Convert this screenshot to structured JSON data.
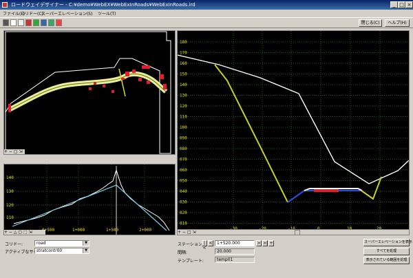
{
  "window": {
    "title": "ロードウェイデザイナー - C:¥demo¥WebEX¥WebExInRoads¥WebExInRoads.ird",
    "minimize": "_",
    "maximize": "□",
    "close": "×"
  },
  "menu": [
    "ファイル(F)",
    "コリドー(C)",
    "スーパーエレベーション(S)",
    "ツール(T)"
  ],
  "toolbar": {
    "close_label": "閉じる(C)",
    "help_label": "ヘルプ(H)"
  },
  "plan_minibar": "+ − □ ⇲",
  "profile_minibar": "+ − △ ▢ ⬚ ⇲",
  "xsection_minibar": "+ − □ ⇲",
  "profile_chart": {
    "y_ticks": [
      "140",
      "130",
      "120",
      "110"
    ],
    "x_ticks": [
      "0+500",
      "1+000",
      "1+500",
      "2+000"
    ]
  },
  "xsection_chart": {
    "y_ticks": [
      "180",
      "170",
      "160",
      "150",
      "140",
      "130",
      "120",
      "110",
      "100",
      "090",
      "080",
      "070",
      "060",
      "050",
      "040",
      "030",
      "020",
      "010"
    ],
    "x_ticks": [
      "-30",
      "-20",
      "-10",
      "0",
      "10",
      "20"
    ]
  },
  "form": {
    "corridor_label": "コリドー:",
    "corridor_value": "road",
    "surface_label": "アクティブなサーフェス:",
    "surface_value": "stratcontr00",
    "station_label": "ステーション:",
    "station_value": "1+520.000",
    "interval_label": "間隔:",
    "interval_value": "20.000",
    "template_label": "テンプレート:",
    "template_value": "temp01",
    "nav_first": "|<",
    "nav_prev": "<",
    "nav_next": ">",
    "nav_last": ">|",
    "nav_add": "+"
  },
  "actions": {
    "show_superelevation": "スーパーエレベーションを表示",
    "process_all": "すべてを処理",
    "process_range": "表示されている範囲を処理"
  }
}
